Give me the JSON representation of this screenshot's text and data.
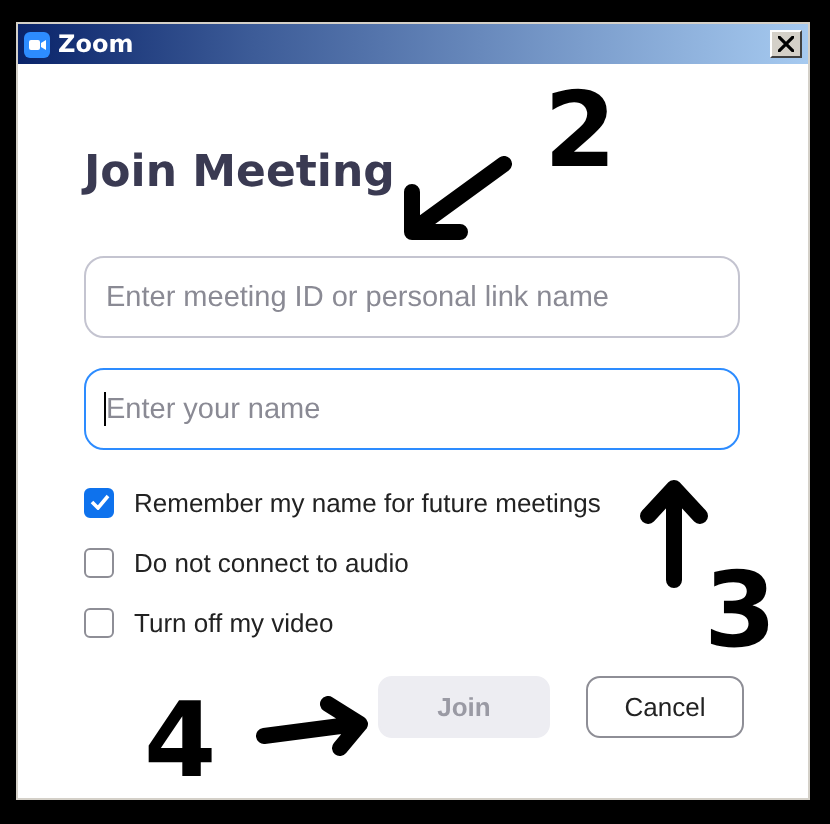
{
  "window": {
    "title": "Zoom"
  },
  "heading": "Join Meeting",
  "fields": [
    {
      "placeholder": "Enter meeting ID or personal link name",
      "focused": false
    },
    {
      "placeholder": "Enter your name",
      "focused": true
    }
  ],
  "options": [
    {
      "label": "Remember my name for future meetings",
      "checked": true
    },
    {
      "label": "Do not connect to audio",
      "checked": false
    },
    {
      "label": "Turn off my video",
      "checked": false
    }
  ],
  "buttons": [
    {
      "label": "Join",
      "disabled": true
    },
    {
      "label": "Cancel",
      "disabled": false
    }
  ],
  "annotations": [
    {
      "label": "2",
      "kind": "downleft"
    },
    {
      "label": "3",
      "kind": "up"
    },
    {
      "label": "4",
      "kind": "right"
    }
  ]
}
